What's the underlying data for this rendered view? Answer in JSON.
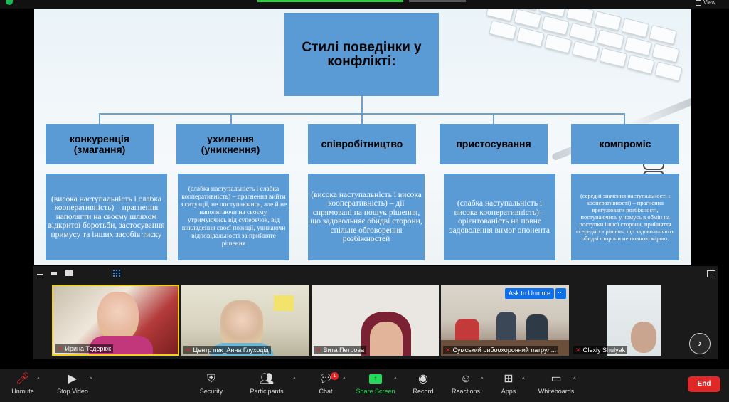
{
  "topbar": {
    "view_label": "View"
  },
  "slide": {
    "title": "Стилі поведінки у конфлікті:",
    "categories": [
      {
        "name": "конкуренція (змагання)",
        "description": "(висока наступальність і слабка кооперативність) – прагнення наполягти на своєму шляхом відкритої боротьби, застосування примусу та інших засобів тиску"
      },
      {
        "name": "ухилення (уникнення)",
        "description": "(слабка наступальність і слабка кооперативність) – прагнення вийти з ситуації, не поступаючись, але й не наполягаючи на своєму, утримуючись від суперечок, від викладення своєї позиції, уникаючи відповідальності за прийняте рішення"
      },
      {
        "name": "співробітництво",
        "description": "(висока наступальність і висока кооперативність) – дії спрямовані на пошук рішення, що задовольняє обидві сторони, спільне обговорення розбіжностей"
      },
      {
        "name": "пристосування",
        "description": "(слабка наступальність і висока кооперативність) – орієнтованість на повне задоволення вимог опонента"
      },
      {
        "name": "компроміс",
        "description": "(середні значення наступальності і кооперативності) – прагнення врегулювати розбіжності, поступаючись у чомусь в обмін на поступки іншої сторони, прийняття «середніх» рішень, що задовольняють обидві сторони не повною мірою."
      }
    ]
  },
  "participants": [
    {
      "name": "Ирина Тодерюк",
      "muted": true,
      "active": true
    },
    {
      "name": "Центр пвк_Анна Глуходід",
      "muted": true
    },
    {
      "name": "Вита Петрова",
      "muted": true
    },
    {
      "name": "Сумський рибоохоронний патрул...",
      "muted": true
    },
    {
      "name": "Olexiy Shulyak",
      "muted": true
    }
  ],
  "tile_controls": {
    "ask_to_unmute": "Ask to Unmute",
    "more": "···"
  },
  "toolbar": {
    "unmute": "Unmute",
    "stop_video": "Stop Video",
    "security": "Security",
    "participants": "Participants",
    "chat": "Chat",
    "chat_badge": "1",
    "share_screen": "Share Screen",
    "record": "Record",
    "reactions": "Reactions",
    "apps": "Apps",
    "whiteboards": "Whiteboards",
    "end": "End"
  },
  "colors": {
    "accent": "#5b9bd5",
    "share_green": "#23d959",
    "end_red": "#e02828",
    "active_border": "#f2d11b"
  }
}
